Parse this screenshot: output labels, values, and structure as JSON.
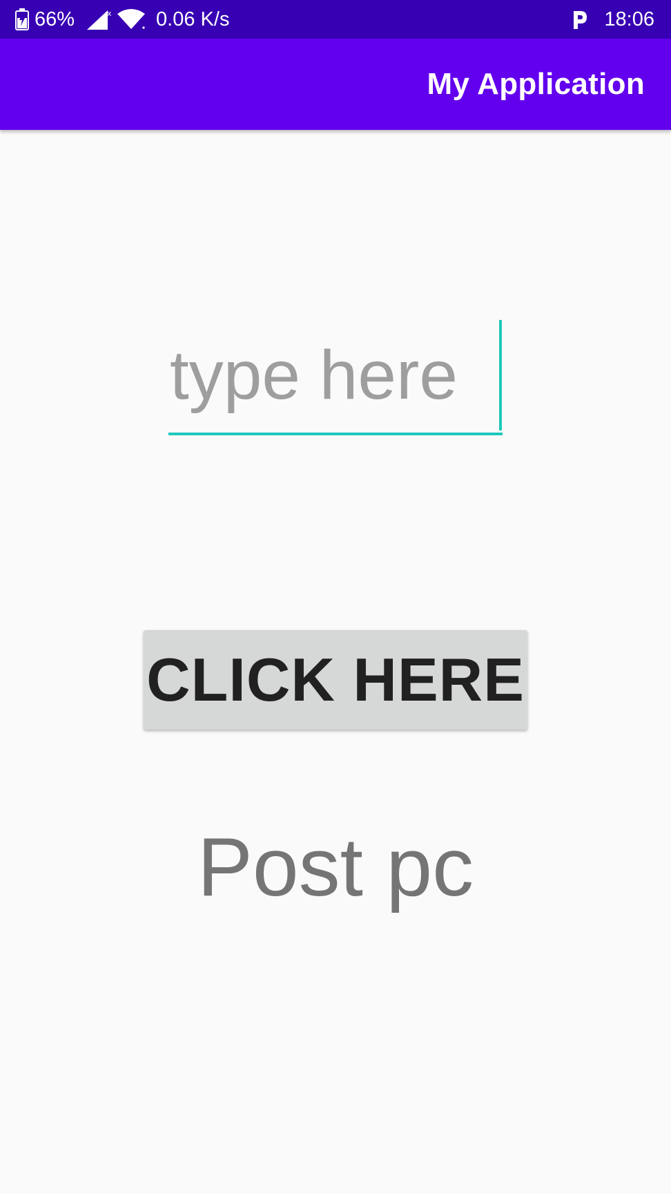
{
  "status_bar": {
    "battery_percent": "66%",
    "net_speed": "0.06 K/s",
    "time": "18:06",
    "icons": [
      "battery-charging-icon",
      "no-signal-icon",
      "wifi-icon",
      "p-notification-icon"
    ]
  },
  "app_bar": {
    "title": "My Application",
    "color": "#6200ee"
  },
  "main": {
    "edit_placeholder": "type here",
    "button_label": "CLICK HERE",
    "result_text": "Post pc"
  },
  "colors": {
    "status_bar": "#3700b3",
    "accent": "#1ec8bd",
    "button": "#d6d7d7"
  }
}
